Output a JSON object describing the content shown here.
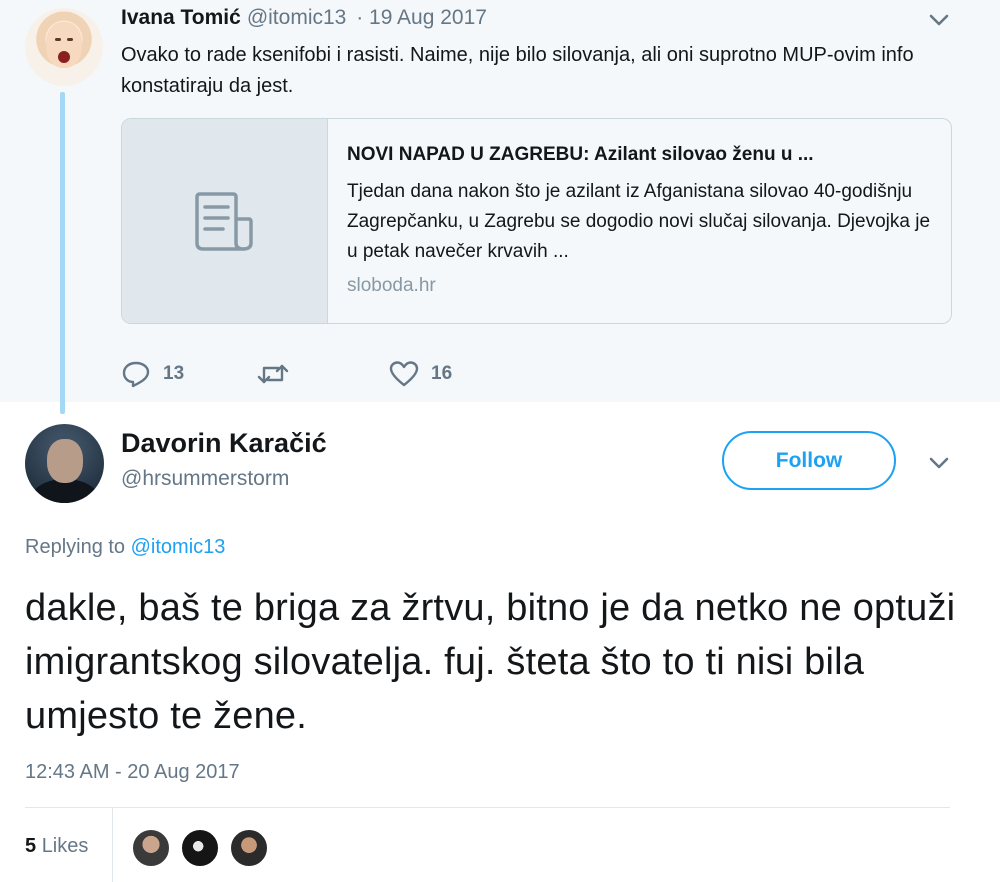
{
  "parent_tweet": {
    "author_name": "Ivana Tomić",
    "author_handle": "@itomic13",
    "date": "· 19 Aug 2017",
    "text": "Ovako to rade ksenifobi i rasisti. Naime, nije bilo silovanja, ali oni suprotno MUP-ovim info konstatiraju da jest.",
    "card": {
      "title": "NOVI NAPAD U ZAGREBU: Azilant silovao ženu u ...",
      "description": "Tjedan dana nakon što je azilant iz Afganistana silovao 40-godišnju Zagrepčanku, u Zagrebu se dogodio novi slučaj silovanja. Djevojka je u petak navečer krvavih ...",
      "domain": "sloboda.hr",
      "thumb_icon": "document-icon"
    },
    "actions": {
      "reply_count": "13",
      "retweet_count": "",
      "like_count": "16"
    }
  },
  "main_tweet": {
    "author_name": "Davorin Karačić",
    "author_handle": "@hrsummerstorm",
    "follow_label": "Follow",
    "replying_prefix": "Replying to ",
    "replying_mention": "@itomic13",
    "text": "dakle, baš te briga za žrtvu, bitno je da netko ne optuži imigrantskog silovatelja. fuj. šteta što to ti nisi bila umjesto te žene.",
    "timestamp": "12:43 AM - 20 Aug 2017",
    "likes_count": "5",
    "likes_label": "Likes"
  },
  "colors": {
    "accent": "#1da1f2",
    "thread_line": "#a5d8f5",
    "muted_text": "#657786",
    "parent_background": "#f5f8fa"
  }
}
